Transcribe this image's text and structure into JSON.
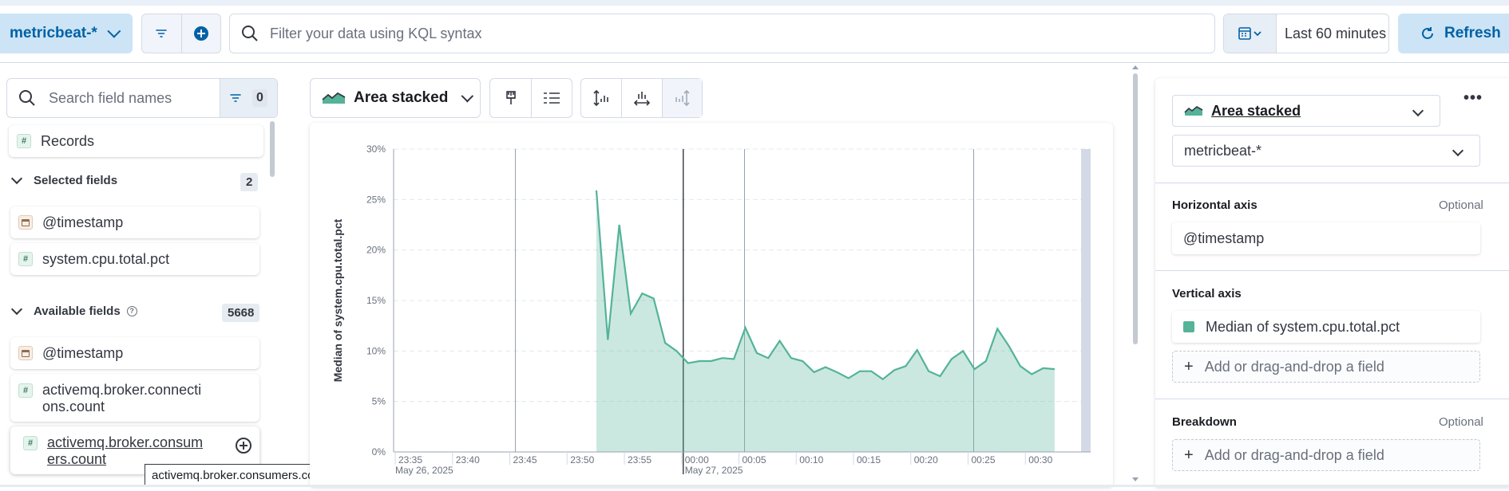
{
  "query_bar": {
    "data_view": "metricbeat-*",
    "kql_placeholder": "Filter your data using KQL syntax",
    "time_range": "Last 60 minutes",
    "refresh_label": "Refresh"
  },
  "field_list": {
    "search_placeholder": "Search field names",
    "filter_count": "0",
    "records_label": "Records",
    "selected": {
      "title": "Selected fields",
      "count": "2",
      "fields": [
        "@timestamp",
        "system.cpu.total.pct"
      ]
    },
    "available": {
      "title": "Available fields",
      "count": "5668",
      "fields": [
        {
          "line1": "@timestamp",
          "line2": ""
        },
        {
          "line1": "activemq.broker.connecti",
          "line2": "ons.count"
        },
        {
          "line1": "activemq.broker.consum",
          "line2": "ers.count"
        }
      ]
    },
    "tooltip": "activemq.broker.consumers.count"
  },
  "workspace": {
    "chart_switch_label": "Area stacked"
  },
  "chart_data": {
    "type": "area",
    "title": "",
    "ylabel": "Median of system.cpu.total.pct",
    "xlabel": "",
    "ylim": [
      0,
      30
    ],
    "yticks": [
      "0%",
      "5%",
      "10%",
      "15%",
      "20%",
      "25%",
      "30%"
    ],
    "xticks": [
      "23:35",
      "23:40",
      "23:45",
      "23:50",
      "23:55",
      "00:00",
      "00:05",
      "00:10",
      "00:15",
      "00:20",
      "00:25",
      "00:30"
    ],
    "date_labels": [
      "May 26, 2025",
      "May 27, 2025"
    ],
    "grid": true,
    "color": "#54b399",
    "series": [
      {
        "x": [
          "23:52",
          "23:53",
          "23:54",
          "23:55",
          "23:56",
          "23:57",
          "23:58",
          "23:59",
          "00:00",
          "00:01",
          "00:02",
          "00:03",
          "00:04",
          "00:05",
          "00:06",
          "00:07",
          "00:08",
          "00:09",
          "00:10",
          "00:11",
          "00:12",
          "00:13",
          "00:14",
          "00:15",
          "00:16",
          "00:17",
          "00:18",
          "00:19",
          "00:20",
          "00:21",
          "00:22",
          "00:23",
          "00:24",
          "00:25",
          "00:26",
          "00:27",
          "00:28",
          "00:29",
          "00:30",
          "00:31",
          "00:32"
        ],
        "values": [
          25.9,
          11.1,
          22.5,
          13.7,
          15.7,
          15.2,
          10.8,
          10.0,
          8.8,
          9.0,
          9.0,
          9.3,
          9.2,
          12.3,
          9.8,
          9.3,
          11.0,
          9.3,
          9.0,
          7.9,
          8.4,
          7.9,
          7.3,
          8.0,
          8.0,
          7.2,
          8.1,
          8.5,
          10.1,
          8.0,
          7.5,
          9.2,
          10.0,
          8.2,
          9.0,
          12.2,
          10.5,
          8.5,
          7.7,
          8.3,
          8.2
        ]
      }
    ]
  },
  "config_panel": {
    "chart_type": "Area stacked",
    "data_view": "metricbeat-*",
    "horizontal_axis": {
      "label": "Horizontal axis",
      "optional": "Optional",
      "field": "@timestamp"
    },
    "vertical_axis": {
      "label": "Vertical axis",
      "field": "Median of system.cpu.total.pct",
      "add": "Add or drag-and-drop a field"
    },
    "breakdown": {
      "label": "Breakdown",
      "optional": "Optional",
      "add": "Add or drag-and-drop a field"
    }
  }
}
